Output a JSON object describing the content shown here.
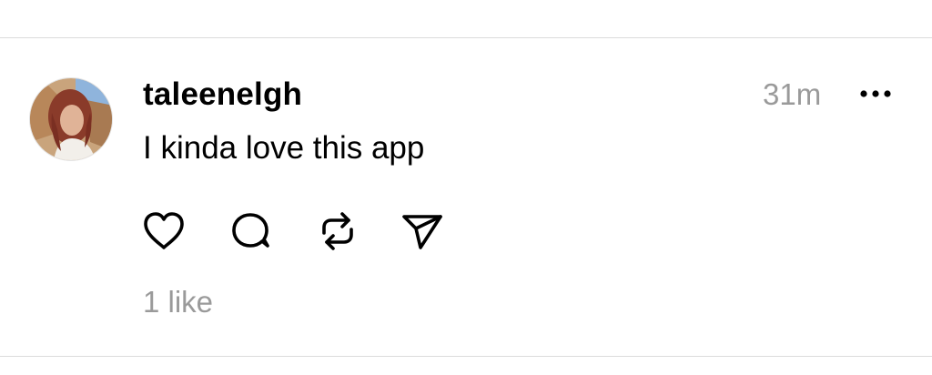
{
  "post": {
    "username": "taleenelgh",
    "timestamp": "31m",
    "text": "I kinda love this app",
    "likes_label": "1 like"
  },
  "icons": {
    "avatar": "avatar-photo",
    "more": "more-horizontal-icon",
    "like": "heart-icon",
    "reply": "comment-bubble-icon",
    "repost": "repost-arrows-icon",
    "share": "send-paper-plane-icon"
  },
  "colors": {
    "text": "#000000",
    "muted": "#9a9a9a",
    "divider": "#dcdcdc",
    "background": "#ffffff"
  }
}
